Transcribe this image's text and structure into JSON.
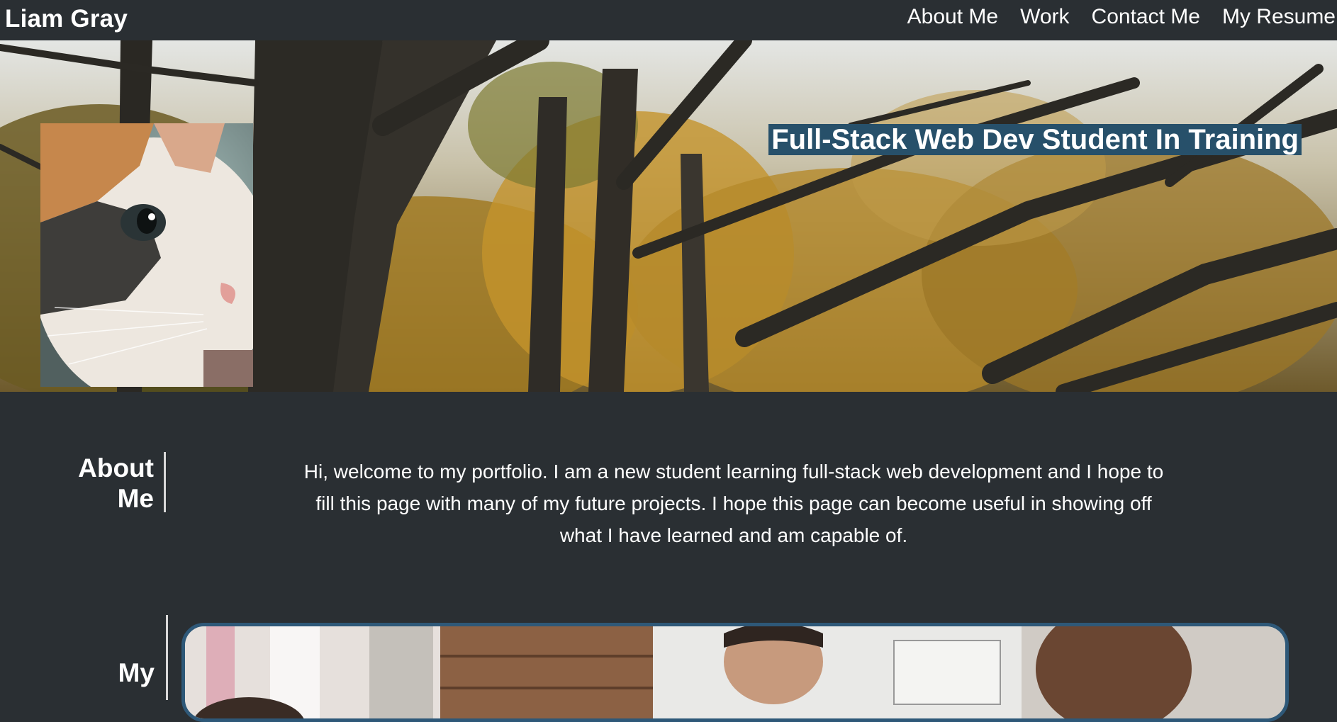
{
  "header": {
    "site_name": "Liam Gray",
    "nav": [
      {
        "label": "About Me"
      },
      {
        "label": "Work"
      },
      {
        "label": "Contact Me"
      },
      {
        "label": "My Resume"
      }
    ]
  },
  "hero": {
    "tagline": "Full-Stack Web Dev Student In Training"
  },
  "about": {
    "heading": "About Me",
    "body": "Hi, welcome to my portfolio. I am a new student learning full-stack web development and I hope to fill this page with many of my future projects. I hope this page can become useful in showing off what I have learned and am capable of."
  },
  "work": {
    "heading": "My"
  },
  "colors": {
    "page_background": "#2a2f33",
    "tagline_background": "#27506a",
    "card_border": "#2e5878"
  }
}
